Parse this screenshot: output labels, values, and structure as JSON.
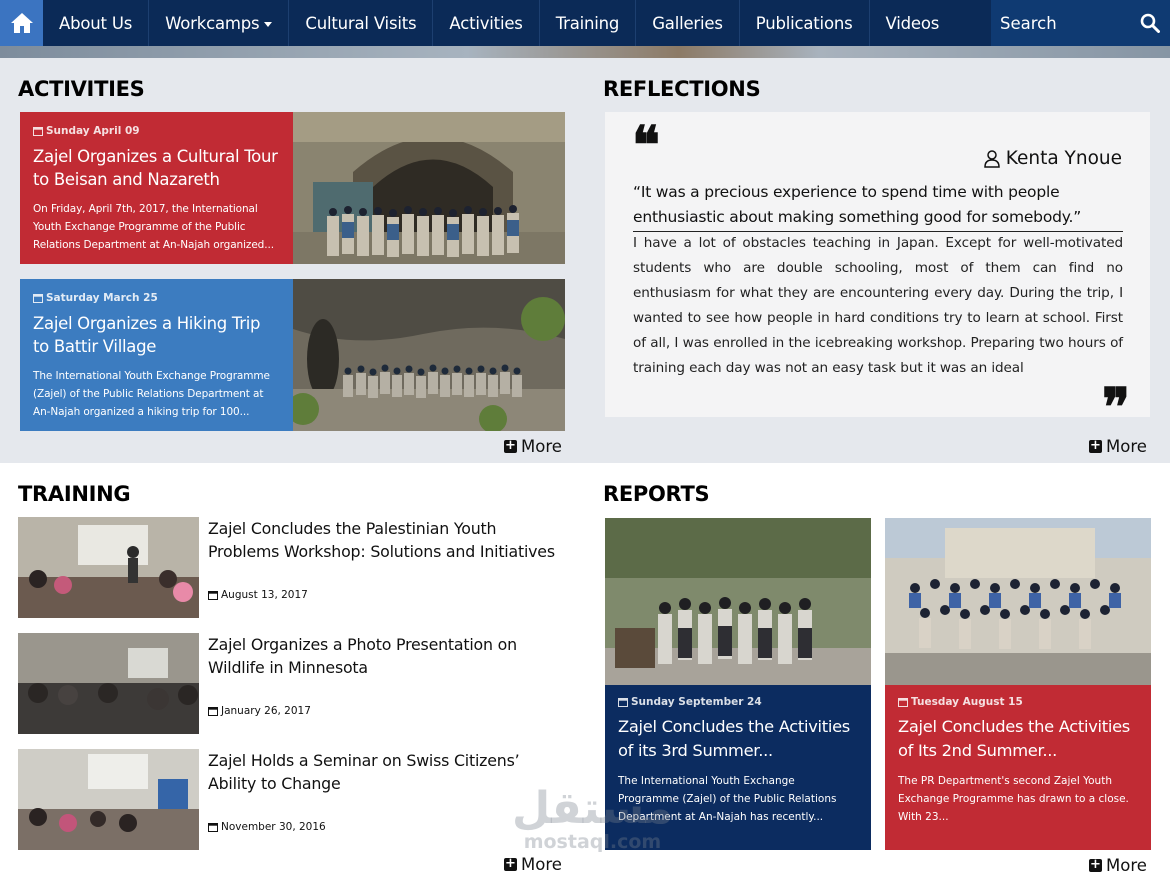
{
  "nav": {
    "items": [
      "About Us",
      "Workcamps",
      "Cultural Visits",
      "Activities",
      "Training",
      "Galleries",
      "Publications",
      "Videos"
    ],
    "search_placeholder": "Search"
  },
  "activities": {
    "heading": "ACTIVITIES",
    "cards": [
      {
        "date": "Sunday April 09",
        "title": "Zajel Organizes a Cultural Tour to Beisan and Nazareth",
        "summary": "On Friday, April 7th, 2017, the International Youth Exchange Programme of the Public Relations Department at An-Najah organized..."
      },
      {
        "date": "Saturday March 25",
        "title": "Zajel Organizes a Hiking Trip to Battir Village",
        "summary": "The International Youth Exchange Programme (Zajel) of the Public Relations Department at An-Najah organized a hiking trip for 100..."
      }
    ],
    "more": "More"
  },
  "reflections": {
    "heading": "REFLECTIONS",
    "author": "Kenta Ynoue",
    "quote": "“It was a precious experience to spend time with people enthusiastic about making something good for somebody.”",
    "body": "I have a lot of obstacles teaching in Japan. Except for well-motivated students who are double schooling, most of them can find no enthusiasm for what they are encountering every day. During the trip, I wanted to see how people in hard conditions try to learn at school. First of all, I was enrolled in the icebreaking workshop. Preparing two hours of training each day was not an easy task but it was an ideal",
    "more": "More"
  },
  "training": {
    "heading": "TRAINING",
    "items": [
      {
        "title": "Zajel Concludes the Palestinian Youth Problems Workshop: Solutions and Initiatives",
        "date": "August 13, 2017"
      },
      {
        "title": "Zajel Organizes a Photo Presentation on Wildlife in Minnesota",
        "date": "January 26, 2017"
      },
      {
        "title": "Zajel Holds a Seminar on Swiss Citizens’ Ability to Change",
        "date": "November 30, 2016"
      }
    ],
    "more": "More"
  },
  "reports": {
    "heading": "REPORTS",
    "items": [
      {
        "date": "Sunday September 24",
        "title": "Zajel Concludes the Activities of its 3rd Summer...",
        "summary": "The International Youth Exchange Programme (Zajel) of the Public Relations Department at An-Najah has recently..."
      },
      {
        "date": "Tuesday August 15",
        "title": "Zajel Concludes the Activities of Its 2nd Summer...",
        "summary": "The PR Department's second Zajel Youth Exchange Programme has drawn to a close. With 23..."
      }
    ],
    "more": "More"
  },
  "watermark": {
    "arabic": "مستقل",
    "latin": "mostaql.com"
  },
  "colors": {
    "nav": "#0b2a57",
    "home": "#3b74c1",
    "card_red": "#c12b34",
    "card_blue": "#3c7cc0",
    "card_navy": "#0c2c60",
    "gray_bg": "#e5e8ed"
  }
}
